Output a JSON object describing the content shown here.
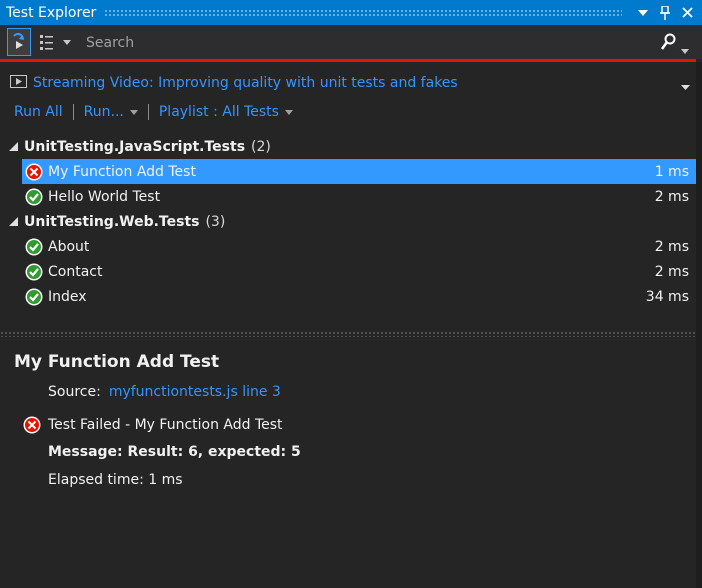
{
  "window": {
    "title": "Test Explorer",
    "icons": [
      "dropdown-icon",
      "pin-icon",
      "close-icon"
    ]
  },
  "toolbar": {
    "search_placeholder": "Search"
  },
  "link_bar": {
    "video_link": "Streaming Video: Improving quality with unit tests and fakes"
  },
  "commands": {
    "run_all": "Run All",
    "run": "Run...",
    "playlist": "Playlist : All Tests"
  },
  "tree": {
    "groups": [
      {
        "name": "UnitTesting.JavaScript.Tests",
        "count": "(2)",
        "tests": [
          {
            "name": "My Function Add Test",
            "duration": "1 ms",
            "status": "failed"
          },
          {
            "name": "Hello World Test",
            "duration": "2 ms",
            "status": "passed"
          }
        ]
      },
      {
        "name": "UnitTesting.Web.Tests",
        "count": "(3)",
        "tests": [
          {
            "name": "About",
            "duration": "2 ms",
            "status": "passed"
          },
          {
            "name": "Contact",
            "duration": "2 ms",
            "status": "passed"
          },
          {
            "name": "Index",
            "duration": "34 ms",
            "status": "passed"
          }
        ]
      }
    ]
  },
  "detail": {
    "title": "My Function Add Test",
    "source_label": "Source:",
    "source_link": "myfunctiontests.js line 3",
    "result_line": "Test Failed - My Function Add Test",
    "message": "Message: Result: 6, expected: 5",
    "elapsed": "Elapsed time: 1 ms"
  },
  "colors": {
    "accent": "#007acc",
    "selection": "#3399ff",
    "link": "#3794ff",
    "fail": "#e51400",
    "pass": "#339933",
    "background": "#252526"
  }
}
